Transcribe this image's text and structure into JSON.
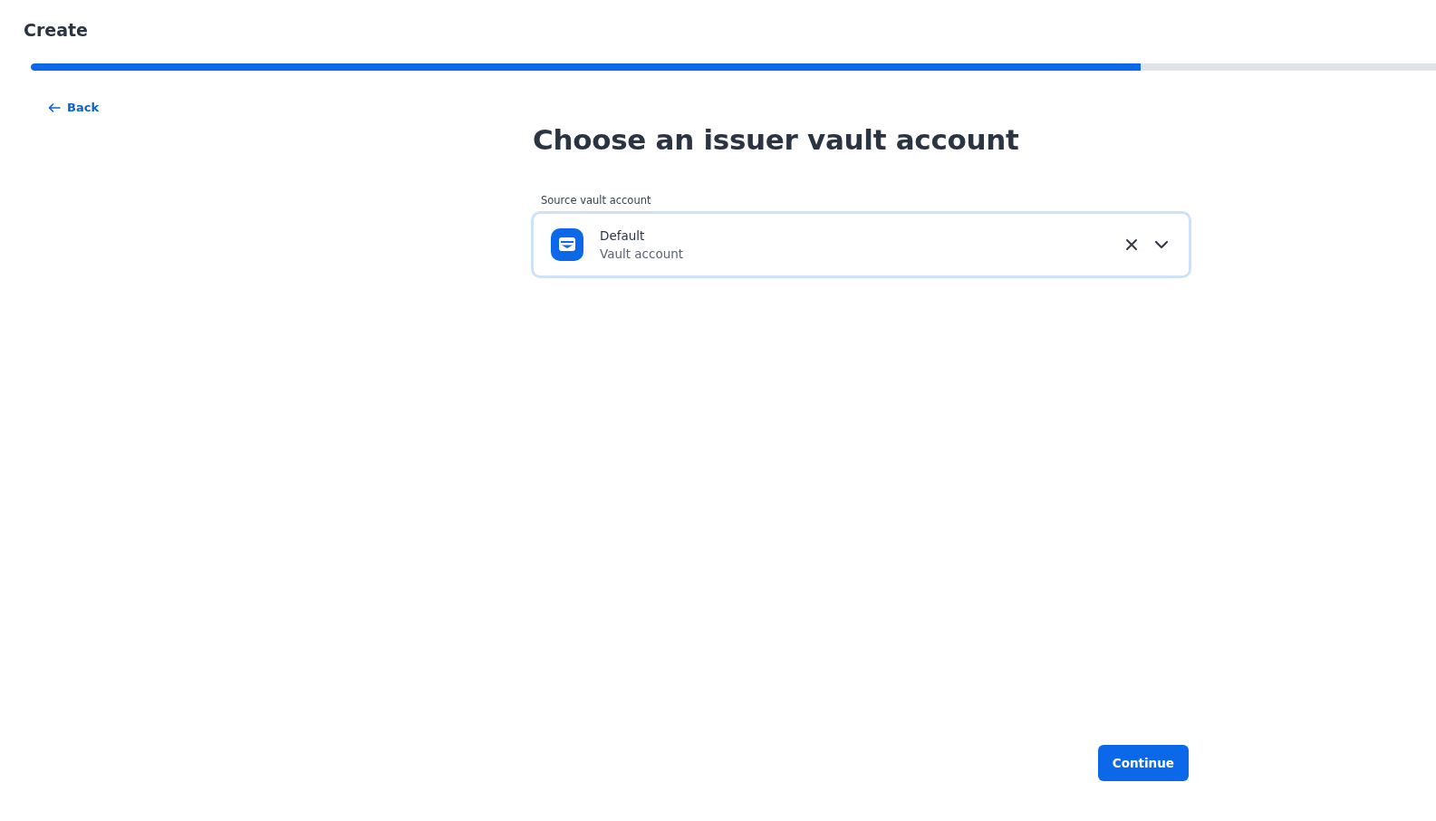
{
  "page": {
    "title": "Create"
  },
  "progress": {
    "level": 0.79
  },
  "back_link": {
    "label": "Back"
  },
  "heading": "Choose an issuer vault account",
  "source_field": {
    "label": "Source vault account",
    "value": "Default",
    "subtitle": "Vault account",
    "focused": true
  },
  "buttons": [
    {
      "label": "Continue"
    }
  ]
}
